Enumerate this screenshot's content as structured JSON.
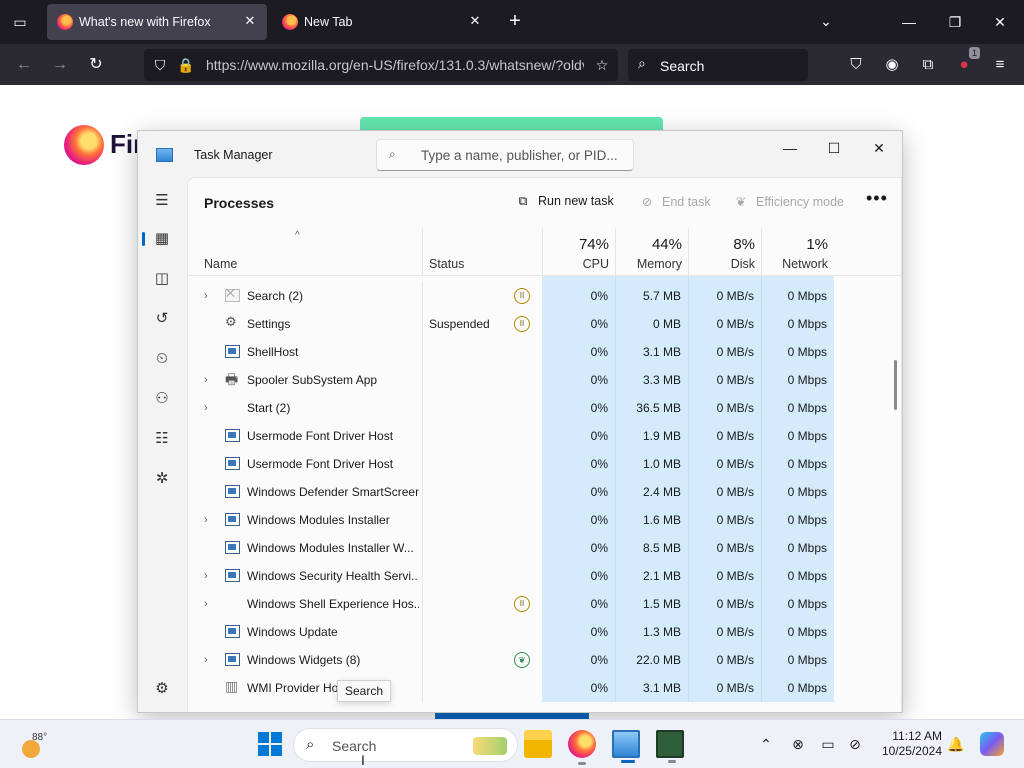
{
  "browser": {
    "tabs": [
      {
        "title": "What's new with Firefox",
        "active": true
      },
      {
        "title": "New Tab",
        "active": false
      }
    ],
    "url": "https://www.mozilla.org/en-US/firefox/131.0.3/whatsnew/?oldv",
    "search_placeholder": "Search",
    "extension_badge": "1",
    "icons": {
      "back": "←",
      "forward": "→",
      "reload": "↻",
      "shield": "⛉",
      "lock": "🔒",
      "star": "☆",
      "search": "⌕",
      "pocket": "⛉",
      "account": "◉",
      "extensions": "⧉",
      "menu": "≡"
    }
  },
  "page": {
    "brand_word": "Firef"
  },
  "task_manager": {
    "title": "Task Manager",
    "search_placeholder": "Type a name, publisher, or PID...",
    "section_title": "Processes",
    "commands": {
      "run_new_task": "Run new task",
      "end_task": "End task",
      "efficiency_mode": "Efficiency mode",
      "more": "•••"
    },
    "columns": {
      "name": "Name",
      "status": "Status",
      "cpu": {
        "label": "CPU",
        "percent": "74%"
      },
      "memory": {
        "label": "Memory",
        "percent": "44%"
      },
      "disk": {
        "label": "Disk",
        "percent": "8%"
      },
      "network": {
        "label": "Network",
        "percent": "1%"
      }
    },
    "processes": [
      {
        "name": "Search (2)",
        "expandable": true,
        "icon": "search",
        "status": "",
        "status_icon": "paused",
        "cpu": "0%",
        "memory": "5.7 MB",
        "disk": "0 MB/s",
        "network": "0 Mbps"
      },
      {
        "name": "Settings",
        "expandable": false,
        "icon": "gear",
        "status": "Suspended",
        "status_icon": "paused",
        "cpu": "0%",
        "memory": "0 MB",
        "disk": "0 MB/s",
        "network": "0 Mbps"
      },
      {
        "name": "ShellHost",
        "expandable": false,
        "icon": "app",
        "status": "",
        "status_icon": "",
        "cpu": "0%",
        "memory": "3.1 MB",
        "disk": "0 MB/s",
        "network": "0 Mbps"
      },
      {
        "name": "Spooler SubSystem App",
        "expandable": true,
        "icon": "printer",
        "status": "",
        "status_icon": "",
        "cpu": "0%",
        "memory": "3.3 MB",
        "disk": "0 MB/s",
        "network": "0 Mbps"
      },
      {
        "name": "Start (2)",
        "expandable": true,
        "icon": "blank",
        "status": "",
        "status_icon": "",
        "cpu": "0%",
        "memory": "36.5 MB",
        "disk": "0 MB/s",
        "network": "0 Mbps"
      },
      {
        "name": "Usermode Font Driver Host",
        "expandable": false,
        "icon": "app",
        "status": "",
        "status_icon": "",
        "cpu": "0%",
        "memory": "1.9 MB",
        "disk": "0 MB/s",
        "network": "0 Mbps"
      },
      {
        "name": "Usermode Font Driver Host",
        "expandable": false,
        "icon": "app",
        "status": "",
        "status_icon": "",
        "cpu": "0%",
        "memory": "1.0 MB",
        "disk": "0 MB/s",
        "network": "0 Mbps"
      },
      {
        "name": "Windows Defender SmartScreen",
        "expandable": false,
        "icon": "app",
        "status": "",
        "status_icon": "",
        "cpu": "0%",
        "memory": "2.4 MB",
        "disk": "0 MB/s",
        "network": "0 Mbps"
      },
      {
        "name": "Windows Modules Installer",
        "expandable": true,
        "icon": "app",
        "status": "",
        "status_icon": "",
        "cpu": "0%",
        "memory": "1.6 MB",
        "disk": "0 MB/s",
        "network": "0 Mbps"
      },
      {
        "name": "Windows Modules Installer W...",
        "expandable": false,
        "icon": "app",
        "status": "",
        "status_icon": "",
        "cpu": "0%",
        "memory": "8.5 MB",
        "disk": "0 MB/s",
        "network": "0 Mbps"
      },
      {
        "name": "Windows Security Health Servi...",
        "expandable": true,
        "icon": "app",
        "status": "",
        "status_icon": "",
        "cpu": "0%",
        "memory": "2.1 MB",
        "disk": "0 MB/s",
        "network": "0 Mbps"
      },
      {
        "name": "Windows Shell Experience Hos...",
        "expandable": true,
        "icon": "blank",
        "status": "",
        "status_icon": "paused",
        "cpu": "0%",
        "memory": "1.5 MB",
        "disk": "0 MB/s",
        "network": "0 Mbps"
      },
      {
        "name": "Windows Update",
        "expandable": false,
        "icon": "app",
        "status": "",
        "status_icon": "",
        "cpu": "0%",
        "memory": "1.3 MB",
        "disk": "0 MB/s",
        "network": "0 Mbps"
      },
      {
        "name": "Windows Widgets (8)",
        "expandable": true,
        "icon": "app",
        "status": "",
        "status_icon": "efficiency",
        "cpu": "0%",
        "memory": "22.0 MB",
        "disk": "0 MB/s",
        "network": "0 Mbps"
      },
      {
        "name": "WMI Provider Ho",
        "expandable": false,
        "icon": "wmi",
        "status": "",
        "status_icon": "",
        "cpu": "0%",
        "memory": "3.1 MB",
        "disk": "0 MB/s",
        "network": "0 Mbps"
      }
    ],
    "tooltip": "Search",
    "nav_icons": [
      "hamburger-icon",
      "processes-icon",
      "performance-icon",
      "app-history-icon",
      "startup-apps-icon",
      "users-icon",
      "details-icon",
      "services-icon",
      "settings-icon"
    ]
  },
  "taskbar": {
    "weather_temp": "88°",
    "search_placeholder": "Search",
    "clock_time": "11:12 AM",
    "clock_date": "10/25/2024"
  },
  "colors": {
    "accent": "#0067c0",
    "cpu_column": "#d3ebfb",
    "firefox_toolbar": "#2b2a33",
    "firefox_tabbar": "#1c1b22"
  }
}
